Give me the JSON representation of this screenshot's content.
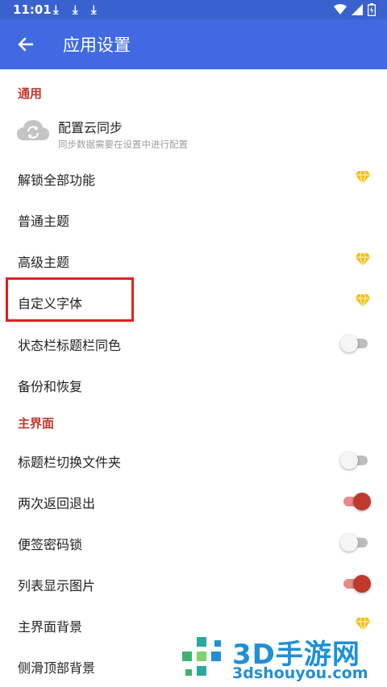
{
  "status_bar": {
    "time": "11:01"
  },
  "app_bar": {
    "title": "应用设置"
  },
  "sections": {
    "general": "通用",
    "main_ui": "主界面"
  },
  "sync": {
    "title": "配置云同步",
    "subtitle": "同步数据需要在设置中进行配置"
  },
  "items": {
    "unlock_all": "解锁全部功能",
    "normal_theme": "普通主题",
    "advanced_theme": "高级主题",
    "custom_font": "自定义字体",
    "statusbar_same_color": "状态栏标题栏同色",
    "backup_restore": "备份和恢复",
    "title_switch_folder": "标题栏切换文件夹",
    "double_back_exit": "两次返回退出",
    "note_password_lock": "便签密码锁",
    "list_show_images": "列表显示图片",
    "main_background": "主界面背景",
    "drawer_top_background": "侧滑顶部背景"
  },
  "toggles": {
    "statusbar_same_color": false,
    "title_switch_folder": false,
    "double_back_exit": true,
    "note_password_lock": false,
    "list_show_images": true
  },
  "colors": {
    "status_bar": "#3a62cf",
    "app_bar": "#4169e1",
    "section_header": "#c0392b",
    "toggle_on": "#c0392b",
    "premium_gem": "#f2c01e",
    "highlight_box": "#e02020"
  },
  "watermark": {
    "brand": "3D手游网",
    "url": "3dshouyou.com"
  }
}
